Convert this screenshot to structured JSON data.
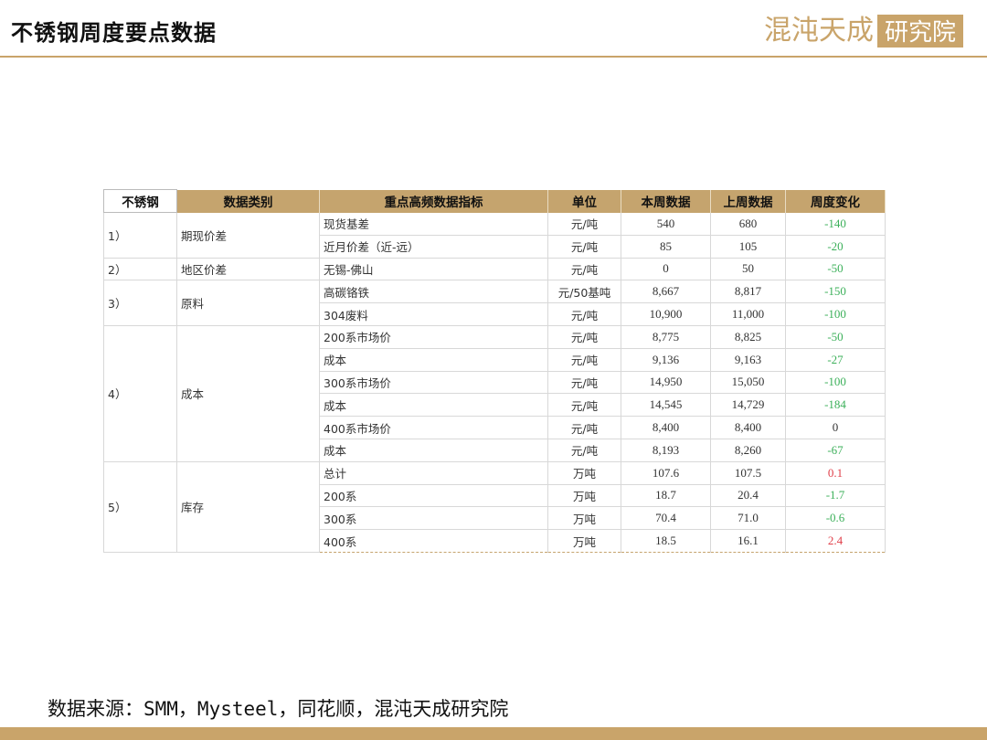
{
  "header": {
    "title": "不锈钢周度要点数据",
    "logo_text": "混沌天成",
    "logo_box": "研究院"
  },
  "table": {
    "columns": [
      "不锈钢",
      "数据类别",
      "重点高频数据指标",
      "单位",
      "本周数据",
      "上周数据",
      "周度变化"
    ],
    "groups": [
      {
        "id": "1）",
        "category": "期现价差",
        "rows": [
          {
            "indicator": "现货基差",
            "unit": "元/吨",
            "this_week": "540",
            "last_week": "680",
            "change": "-140",
            "change_color": "green"
          },
          {
            "indicator": "近月价差（近-远）",
            "unit": "元/吨",
            "this_week": "85",
            "last_week": "105",
            "change": "-20",
            "change_color": "green"
          }
        ]
      },
      {
        "id": "2）",
        "category": "地区价差",
        "rows": [
          {
            "indicator": "无锡-佛山",
            "unit": "元/吨",
            "this_week": "0",
            "last_week": "50",
            "change": "-50",
            "change_color": "green"
          }
        ]
      },
      {
        "id": "3）",
        "category": "原料",
        "rows": [
          {
            "indicator": "高碳铬铁",
            "unit": "元/50基吨",
            "this_week": "8,667",
            "last_week": "8,817",
            "change": "-150",
            "change_color": "green"
          },
          {
            "indicator": "304废料",
            "unit": "元/吨",
            "this_week": "10,900",
            "last_week": "11,000",
            "change": "-100",
            "change_color": "green"
          }
        ]
      },
      {
        "id": "4）",
        "category": "成本",
        "rows": [
          {
            "indicator": "200系市场价",
            "unit": "元/吨",
            "this_week": "8,775",
            "last_week": "8,825",
            "change": "-50",
            "change_color": "green"
          },
          {
            "indicator": "成本",
            "unit": "元/吨",
            "this_week": "9,136",
            "last_week": "9,163",
            "change": "-27",
            "change_color": "green"
          },
          {
            "indicator": "300系市场价",
            "unit": "元/吨",
            "this_week": "14,950",
            "last_week": "15,050",
            "change": "-100",
            "change_color": "green"
          },
          {
            "indicator": "成本",
            "unit": "元/吨",
            "this_week": "14,545",
            "last_week": "14,729",
            "change": "-184",
            "change_color": "green"
          },
          {
            "indicator": "400系市场价",
            "unit": "元/吨",
            "this_week": "8,400",
            "last_week": "8,400",
            "change": "0",
            "change_color": "black"
          },
          {
            "indicator": "成本",
            "unit": "元/吨",
            "this_week": "8,193",
            "last_week": "8,260",
            "change": "-67",
            "change_color": "green"
          }
        ]
      },
      {
        "id": "5）",
        "category": "库存",
        "rows": [
          {
            "indicator": "总计",
            "unit": "万吨",
            "this_week": "107.6",
            "last_week": "107.5",
            "change": "0.1",
            "change_color": "red"
          },
          {
            "indicator": "200系",
            "unit": "万吨",
            "this_week": "18.7",
            "last_week": "20.4",
            "change": "-1.7",
            "change_color": "green"
          },
          {
            "indicator": "300系",
            "unit": "万吨",
            "this_week": "70.4",
            "last_week": "71.0",
            "change": "-0.6",
            "change_color": "green"
          },
          {
            "indicator": "400系",
            "unit": "万吨",
            "this_week": "18.5",
            "last_week": "16.1",
            "change": "2.4",
            "change_color": "red"
          }
        ]
      }
    ]
  },
  "footer": {
    "source": "数据来源：SMM，Mysteel，同花顺，混沌天成研究院"
  },
  "colors": {
    "accent": "#c9a46a",
    "header_fill": "#c5a46e",
    "decrease": "#3cb05a",
    "increase": "#e0404a"
  }
}
